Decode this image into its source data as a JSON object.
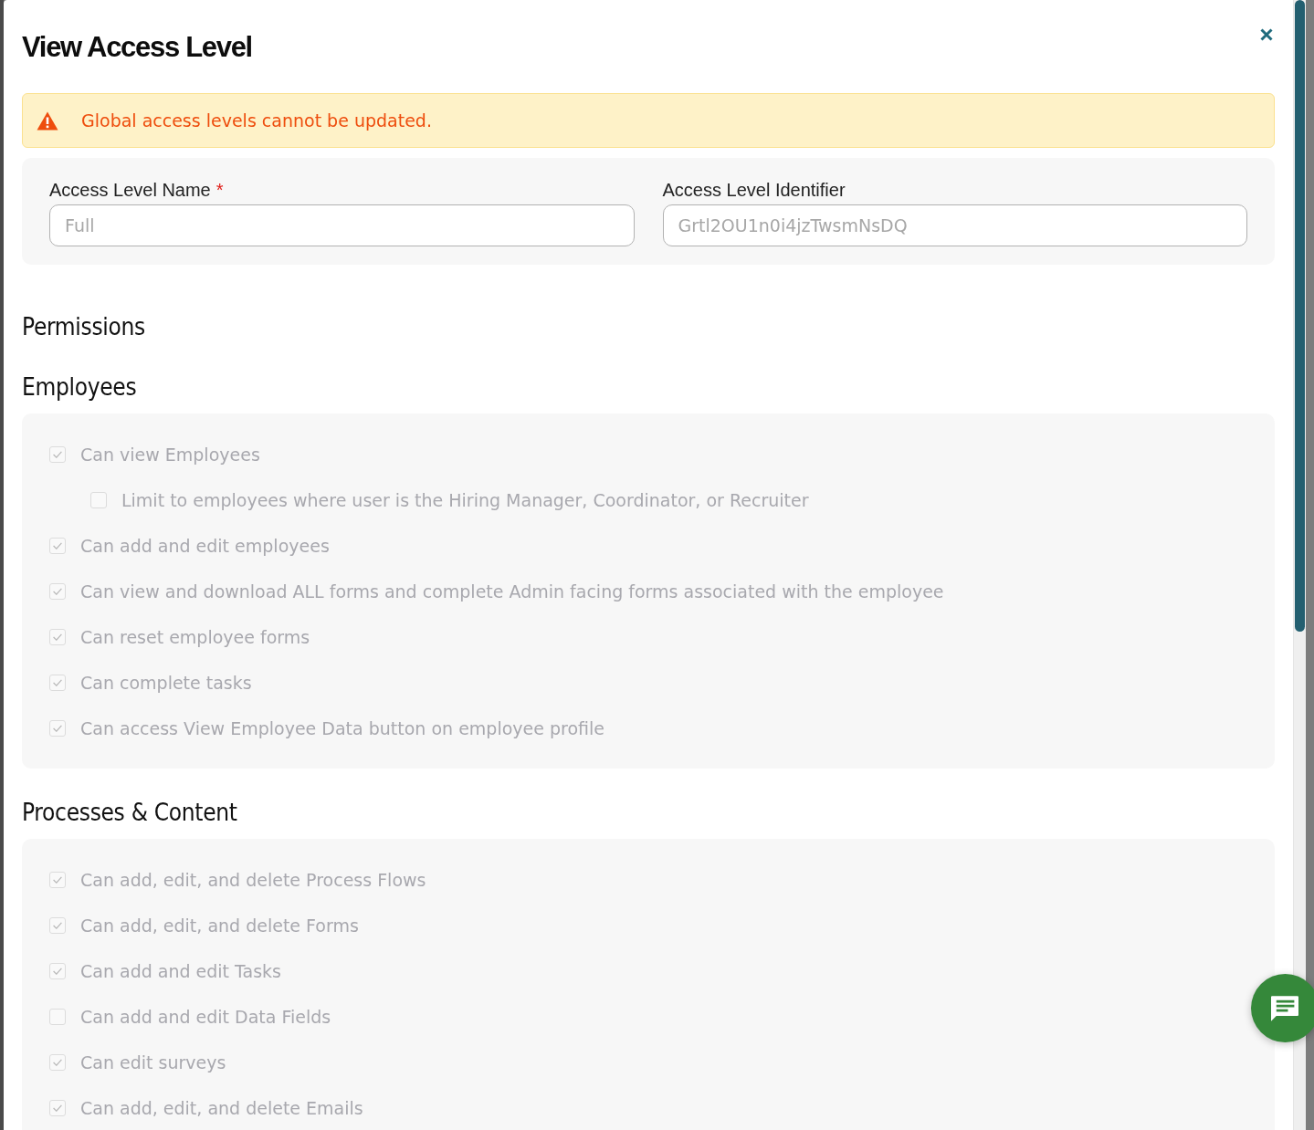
{
  "dialog": {
    "title": "View Access Level"
  },
  "alert": {
    "message": "Global access levels cannot be updated."
  },
  "fields": [
    {
      "label": "Access Level Name",
      "required_marker": "*",
      "value": "Full",
      "disabled": true
    },
    {
      "label": "Access Level Identifier",
      "value": "Grtl2OU1n0i4jzTwsmNsDQ",
      "disabled": true
    }
  ],
  "permissions": {
    "title": "Permissions",
    "sections": [
      {
        "title": "Employees",
        "items": [
          {
            "label": "Can view Employees",
            "checked": true,
            "disabled": true,
            "children": [
              {
                "label": "Limit to employees where user is the Hiring Manager, Coordinator, or Recruiter",
                "checked": false,
                "disabled": true
              }
            ]
          },
          {
            "label": "Can add and edit employees",
            "checked": true,
            "disabled": true
          },
          {
            "label": "Can view and download ALL forms and complete Admin facing forms associated with the employee",
            "checked": true,
            "disabled": true
          },
          {
            "label": "Can reset employee forms",
            "checked": true,
            "disabled": true
          },
          {
            "label": "Can complete tasks",
            "checked": true,
            "disabled": true
          },
          {
            "label": "Can access View Employee Data button on employee profile",
            "checked": true,
            "disabled": true
          }
        ]
      },
      {
        "title": "Processes & Content",
        "items": [
          {
            "label": "Can add, edit, and delete Process Flows",
            "checked": true,
            "disabled": true
          },
          {
            "label": "Can add, edit, and delete Forms",
            "checked": true,
            "disabled": true
          },
          {
            "label": "Can add and edit Tasks",
            "checked": true,
            "disabled": true
          },
          {
            "label": "Can add and edit Data Fields",
            "checked": false,
            "disabled": true
          },
          {
            "label": "Can edit surveys",
            "checked": true,
            "disabled": true
          },
          {
            "label": "Can add, edit, and delete Emails",
            "checked": true,
            "disabled": true
          }
        ]
      }
    ]
  }
}
